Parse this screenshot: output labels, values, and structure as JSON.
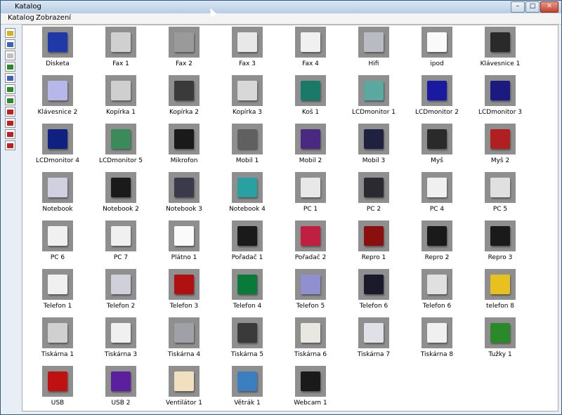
{
  "window": {
    "title": "Katalog",
    "buttons": [
      "–",
      "□",
      "✕"
    ]
  },
  "menu": [
    "Katalog",
    "Zobrazení"
  ],
  "toolbar_icons": [
    "folder-icon",
    "grid-icon",
    "filter-icon",
    "image-list-icon",
    "tree-icon",
    "picture-icon",
    "picture2-icon",
    "tools-icon",
    "red-doc-icon",
    "red-doc2-icon",
    "red-doc3-icon"
  ],
  "items": [
    {
      "label": "Disketa",
      "color": "#1e3aa8"
    },
    {
      "label": "Fax 1",
      "color": "#d0d0d0"
    },
    {
      "label": "Fax 2",
      "color": "#9a9a9a"
    },
    {
      "label": "Fax 3",
      "color": "#e8e8e8"
    },
    {
      "label": "Fax 4",
      "color": "#f0f0f0"
    },
    {
      "label": "Hifi",
      "color": "#b8bcc2"
    },
    {
      "label": "ipod",
      "color": "#fafafa"
    },
    {
      "label": "Klávesnice 1",
      "color": "#2a2a2a"
    },
    {
      "label": "Klávesnice 2",
      "color": "#b5b8e8"
    },
    {
      "label": "Kopírka 1",
      "color": "#cfcfcf"
    },
    {
      "label": "Kopírka 2",
      "color": "#3a3a3a"
    },
    {
      "label": "Kopírka 3",
      "color": "#d8d8d8"
    },
    {
      "label": "Koš 1",
      "color": "#1a7a6a"
    },
    {
      "label": "LCDmonitor 1",
      "color": "#5aa8a0"
    },
    {
      "label": "LCDmonitor 2",
      "color": "#1a1aa0"
    },
    {
      "label": "LCDmonitor 3",
      "color": "#1a1a80"
    },
    {
      "label": "LCDmonitor 4",
      "color": "#102080"
    },
    {
      "label": "LCDmonitor 5",
      "color": "#3a8a5a"
    },
    {
      "label": "Mikrofon",
      "color": "#1a1a1a"
    },
    {
      "label": "Mobil 1",
      "color": "#606060"
    },
    {
      "label": "Mobil 2",
      "color": "#4a2a80"
    },
    {
      "label": "Mobil 3",
      "color": "#202040"
    },
    {
      "label": "Myš",
      "color": "#2a2a2a"
    },
    {
      "label": "Myš 2",
      "color": "#b02020"
    },
    {
      "label": "Notebook",
      "color": "#d0d0e0"
    },
    {
      "label": "Notebook 2",
      "color": "#1a1a1a"
    },
    {
      "label": "Notebook 3",
      "color": "#3a3a4a"
    },
    {
      "label": "Notebook 4",
      "color": "#2aa0a0"
    },
    {
      "label": "PC 1",
      "color": "#e8e8e8"
    },
    {
      "label": "PC 2",
      "color": "#2a2a30"
    },
    {
      "label": "PC 4",
      "color": "#f0f0f0"
    },
    {
      "label": "PC 5",
      "color": "#e0e0e0"
    },
    {
      "label": "PC 6",
      "color": "#f0f0f0"
    },
    {
      "label": "PC 7",
      "color": "#f0f0f0"
    },
    {
      "label": "Plátno 1",
      "color": "#fafafa"
    },
    {
      "label": "Pořadač 1",
      "color": "#1a1a1a"
    },
    {
      "label": "Pořadač 2",
      "color": "#c02040"
    },
    {
      "label": "Repro 1",
      "color": "#8a1010"
    },
    {
      "label": "Repro 2",
      "color": "#1a1a1a"
    },
    {
      "label": "Repro 3",
      "color": "#1a1a1a"
    },
    {
      "label": "Telefon 1",
      "color": "#f0f0f0"
    },
    {
      "label": "Telefon 2",
      "color": "#d0d0d8"
    },
    {
      "label": "Telefon 3",
      "color": "#b01010"
    },
    {
      "label": "Telefon 4",
      "color": "#0a7a3a"
    },
    {
      "label": "Telefon 5",
      "color": "#9090d0"
    },
    {
      "label": "Telefon 6",
      "color": "#1a1a2a"
    },
    {
      "label": "Telefon 6",
      "color": "#e0e0e0"
    },
    {
      "label": "telefon 8",
      "color": "#e8c020"
    },
    {
      "label": "Tiskárna 1",
      "color": "#d0d0d0"
    },
    {
      "label": "Tiskárna 3",
      "color": "#f0f0f0"
    },
    {
      "label": "Tiskárna 4",
      "color": "#a0a0a8"
    },
    {
      "label": "Tiskárna 5",
      "color": "#3a3a3a"
    },
    {
      "label": "Tiskárna 6",
      "color": "#e8e8e0"
    },
    {
      "label": "Tiskárna 7",
      "color": "#e0e0e8"
    },
    {
      "label": "Tiskárna 8",
      "color": "#f0f0f0"
    },
    {
      "label": "Tužky 1",
      "color": "#2a8a2a"
    },
    {
      "label": "USB",
      "color": "#c01010"
    },
    {
      "label": "USB 2",
      "color": "#5a20a0"
    },
    {
      "label": "Ventilátor 1",
      "color": "#f0e0c0"
    },
    {
      "label": "Větrák 1",
      "color": "#3a80c0"
    },
    {
      "label": "Webcam 1",
      "color": "#1a1a1a"
    }
  ],
  "accent": "#3a5a7a"
}
